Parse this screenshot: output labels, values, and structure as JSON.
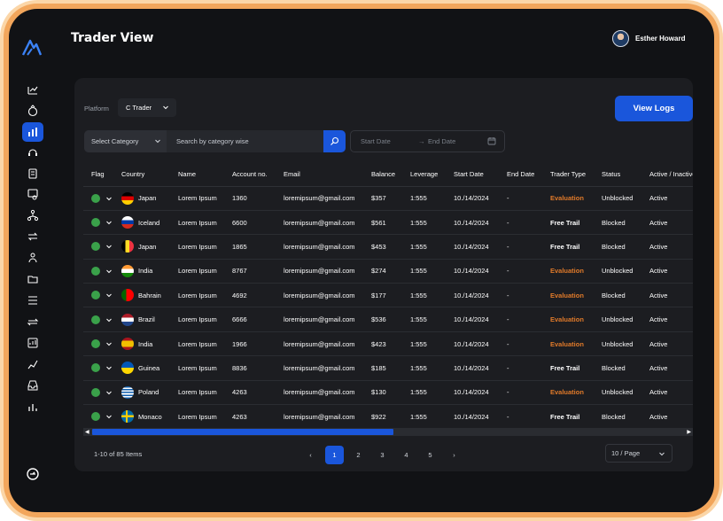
{
  "header": {
    "title": "Trader View",
    "user_name": "Esther Howard"
  },
  "sidebar": {
    "icons": [
      "trading-icon",
      "money-bag-icon",
      "chart-icon",
      "support-icon",
      "document-icon",
      "certificate-icon",
      "network-icon",
      "exchange-icon",
      "user-group-icon",
      "folder-icon",
      "list-icon",
      "transfer-icon",
      "report-icon",
      "growth-icon",
      "inbox-icon",
      "analytics-icon"
    ],
    "active_index": 2
  },
  "filters": {
    "platform_label": "Platform",
    "platform_value": "C Trader",
    "view_logs_label": "View Logs",
    "category_label": "Select Category",
    "search_placeholder": "Search by category wise",
    "start_date_placeholder": "Start Date",
    "arrow": "→",
    "end_date_placeholder": "End Date"
  },
  "table": {
    "columns": [
      "Flag",
      "Country",
      "Name",
      "Account no.",
      "Email",
      "Balance",
      "Leverage",
      "Start Date",
      "End Date",
      "Trader Type",
      "Status",
      "Active / Inactive"
    ],
    "rows": [
      {
        "country": "Japan",
        "flag": "germany",
        "name": "Lorem Ipsum",
        "account": "1360",
        "email": "loremipsum@gmail.com",
        "balance": "$357",
        "leverage": "1:555",
        "start": "10./14/2024",
        "end": "-",
        "type": "Evaluation",
        "status": "Unblocked",
        "active": "Active"
      },
      {
        "country": "Iceland",
        "flag": "russia",
        "name": "Lorem Ipsum",
        "account": "6600",
        "email": "loremipsum@gmail.com",
        "balance": "$561",
        "leverage": "1:555",
        "start": "10./14/2024",
        "end": "-",
        "type": "Free Trail",
        "status": "Blocked",
        "active": "Active"
      },
      {
        "country": "Japan",
        "flag": "belgium",
        "name": "Lorem Ipsum",
        "account": "1865",
        "email": "loremipsum@gmail.com",
        "balance": "$453",
        "leverage": "1:555",
        "start": "10./14/2024",
        "end": "-",
        "type": "Free Trail",
        "status": "Blocked",
        "active": "Active"
      },
      {
        "country": "India",
        "flag": "india",
        "name": "Lorem Ipsum",
        "account": "8767",
        "email": "loremipsum@gmail.com",
        "balance": "$274",
        "leverage": "1:555",
        "start": "10./14/2024",
        "end": "-",
        "type": "Evaluation",
        "status": "Unblocked",
        "active": "Active"
      },
      {
        "country": "Bahrain",
        "flag": "portugal",
        "name": "Lorem Ipsum",
        "account": "4692",
        "email": "loremipsum@gmail.com",
        "balance": "$177",
        "leverage": "1:555",
        "start": "10./14/2024",
        "end": "-",
        "type": "Evaluation",
        "status": "Blocked",
        "active": "Active"
      },
      {
        "country": "Brazil",
        "flag": "netherlands",
        "name": "Lorem Ipsum",
        "account": "6666",
        "email": "loremipsum@gmail.com",
        "balance": "$536",
        "leverage": "1:555",
        "start": "10./14/2024",
        "end": "-",
        "type": "Evaluation",
        "status": "Unblocked",
        "active": "Active"
      },
      {
        "country": "India",
        "flag": "spain",
        "name": "Lorem Ipsum",
        "account": "1966",
        "email": "loremipsum@gmail.com",
        "balance": "$423",
        "leverage": "1:555",
        "start": "10./14/2024",
        "end": "-",
        "type": "Evaluation",
        "status": "Unblocked",
        "active": "Active"
      },
      {
        "country": "Guinea",
        "flag": "ukraine",
        "name": "Lorem Ipsum",
        "account": "8836",
        "email": "loremipsum@gmail.com",
        "balance": "$185",
        "leverage": "1:555",
        "start": "10./14/2024",
        "end": "-",
        "type": "Free Trail",
        "status": "Blocked",
        "active": "Active"
      },
      {
        "country": "Poland",
        "flag": "greece",
        "name": "Lorem Ipsum",
        "account": "4263",
        "email": "loremipsum@gmail.com",
        "balance": "$130",
        "leverage": "1:555",
        "start": "10./14/2024",
        "end": "-",
        "type": "Evaluation",
        "status": "Unblocked",
        "active": "Active"
      },
      {
        "country": "Monaco",
        "flag": "sweden",
        "name": "Lorem Ipsum",
        "account": "4263",
        "email": "loremipsum@gmail.com",
        "balance": "$922",
        "leverage": "1:555",
        "start": "10./14/2024",
        "end": "-",
        "type": "Free Trail",
        "status": "Blocked",
        "active": "Active"
      }
    ]
  },
  "pagination": {
    "items_text": "1-10 of 85 Items",
    "prev": "‹",
    "next": "›",
    "pages": [
      "1",
      "2",
      "3",
      "4",
      "5"
    ],
    "current": "1",
    "page_size": "10 / Page"
  },
  "colors": {
    "accent": "#1a56db",
    "evaluation": "#e07a2a",
    "status_dot": "#3aa14a",
    "frame": "#f2a65c"
  }
}
